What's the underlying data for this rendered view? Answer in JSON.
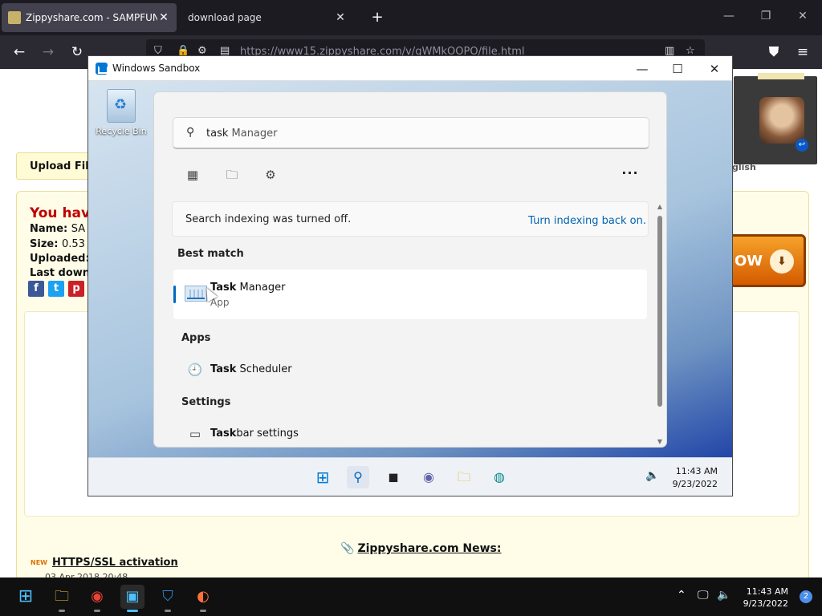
{
  "browser": {
    "tabs": [
      {
        "title": "Zippyshare.com - SAMPFUNCS",
        "close": "✕"
      },
      {
        "title": "download page",
        "close": "✕"
      }
    ],
    "new_tab": "+",
    "url": "https://www15.zippyshare.com/v/gWMkOOPO/file.html"
  },
  "webpage": {
    "upload_label": "Upload Files",
    "warning": "You hav",
    "name_label": "Name:",
    "name_value": "SA",
    "size_label": "Size:",
    "size_value": "0.53",
    "uploaded_label": "Uploaded:",
    "last_label": "Last down",
    "download_button": "OW",
    "language": "glish",
    "news_title": "Zippyshare.com News:",
    "news_item": "HTTPS/SSL activation",
    "news_date": "03 Apr 2018 20:48"
  },
  "sandbox": {
    "title": "Windows Sandbox",
    "recycle_bin": "Recycle Bin",
    "search": {
      "typed": "task",
      "rest": " Manager"
    },
    "info": {
      "message": "Search indexing was turned off.",
      "link": "Turn indexing back on."
    },
    "best_match_heading": "Best match",
    "best_match": {
      "bold": "Task",
      "rest": " Manager",
      "type": "App"
    },
    "apps_heading": "Apps",
    "apps": [
      {
        "bold": "Task",
        "rest": " Scheduler"
      }
    ],
    "settings_heading": "Settings",
    "settings": [
      {
        "bold": "Task",
        "rest": "bar settings"
      }
    ],
    "clock": {
      "time": "11:43 AM",
      "date": "9/23/2022"
    }
  },
  "host_taskbar": {
    "time": "11:43 AM",
    "date": "9/23/2022",
    "notifications": "2"
  }
}
